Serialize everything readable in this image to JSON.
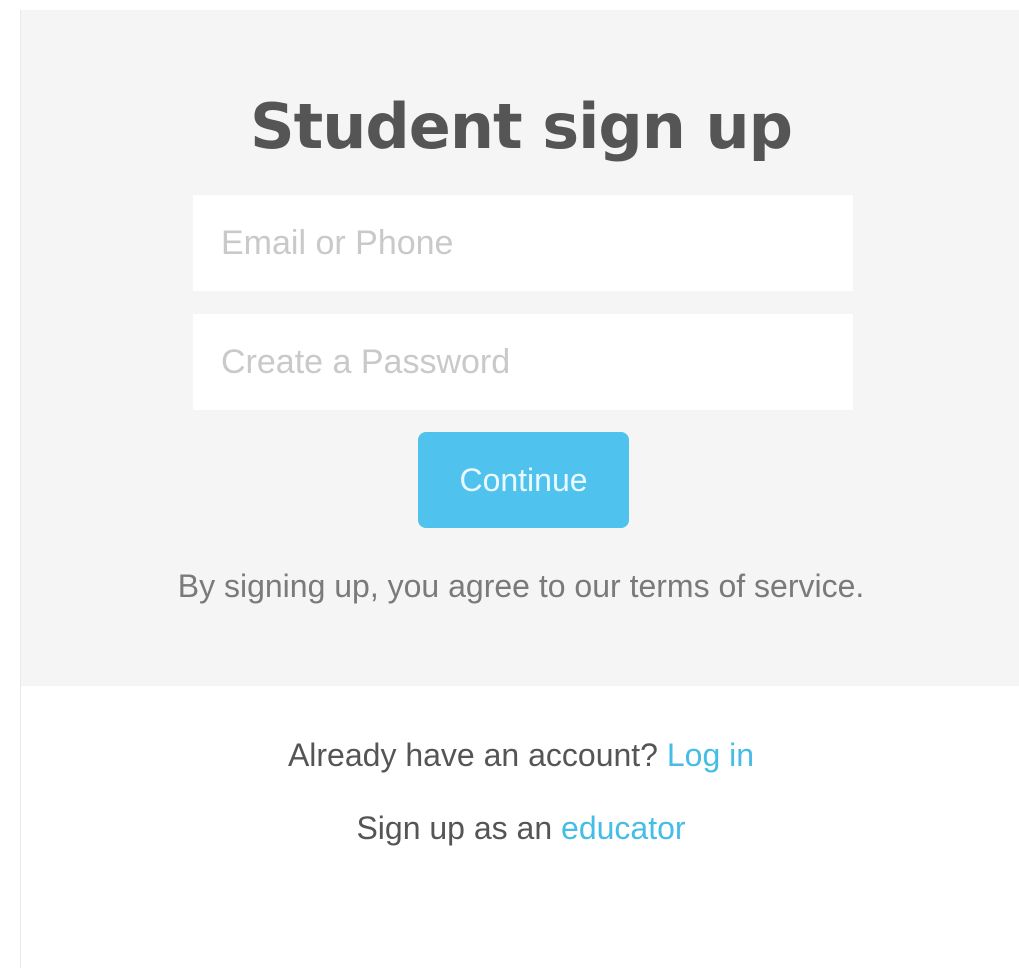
{
  "signup": {
    "title": "Student sign up",
    "email_placeholder": "Email or Phone",
    "password_placeholder": "Create a Password",
    "continue_label": "Continue",
    "terms_text": "By signing up, you agree to our terms of service."
  },
  "footer": {
    "login_prompt": "Already have an account?",
    "login_link": "Log in",
    "educator_prompt": "Sign up as an",
    "educator_link": "educator"
  },
  "colors": {
    "accent": "#4fc3ee",
    "link": "#45bde6",
    "panel_background": "#f5f5f5",
    "title_text": "#555555"
  }
}
